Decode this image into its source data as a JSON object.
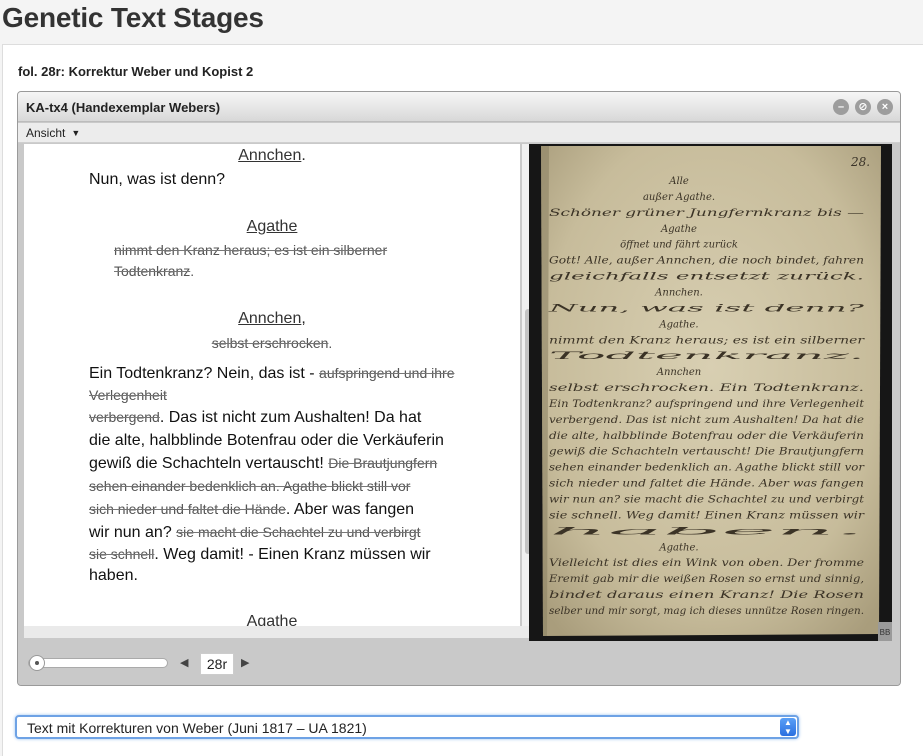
{
  "page": {
    "title": "Genetic Text Stages",
    "folio_title": "fol. 28r: Korrektur Weber und Kopist 2"
  },
  "viewer": {
    "title": "KA-tx4 (Handexemplar Webers)",
    "menu": {
      "view_label": "Ansicht"
    },
    "window_buttons": [
      "minimize",
      "restore",
      "close"
    ]
  },
  "edition": {
    "speaker_1": "Annchen",
    "speaker_1_punct": ".",
    "line_1": "Nun, was ist denn?",
    "speaker_2": "Agathe",
    "stage_2a": "nimmt den Kranz heraus; es ist ein silberner",
    "stage_2b": "Todtenkranz",
    "stage_2b_punct": ".",
    "speaker_3": "Annchen",
    "speaker_3_punct": ",",
    "stage_3": "selbst erschrocken",
    "stage_3_punct": ".",
    "l1_text": "Ein Todtenkranz? Nein, das ist - ",
    "l1_stage": "aufspringend und ihre",
    "l2_stage": "Verlegenheit",
    "l3_stage": "verbergend",
    "l3_text": ". Das ist nicht zum Aushalten! Da hat",
    "l4_text": "die alte, halbblinde Botenfrau oder die Verkäuferin",
    "l5_text": "gewiß die Schachteln vertauscht! ",
    "l5_stage": "Die Brautjungfern",
    "l6_stage": "sehen einander bedenklich an. Agathe blickt still vor",
    "l7_stage": "sich nieder und faltet die Hände",
    "l7_text": ". Aber was fangen",
    "l8_text": "wir nun an? ",
    "l8_stage": "sie macht die Schachtel zu und verbirgt",
    "l9_stage": "sie schnell",
    "l9_text": ". Weg damit! - Einen Kranz müssen wir",
    "l10_text": "haben.",
    "speaker_4": "Agathe"
  },
  "manuscript": {
    "folio_number": "28.",
    "corner_mark": "BB",
    "lines": [
      "Alle",
      "außer Agathe.",
      "Schöner grüner Jungfernkranz bis —",
      "Agathe",
      "öffnet und fährt zurück",
      "Gott! Alle, außer Annchen, die noch bindet, fahren",
      "gleichfalls entsetzt zurück.",
      "Annchen.",
      "Nun, was ist denn?",
      "Agathe.",
      "nimmt den Kranz heraus; es ist ein silberner",
      "Todtenkranz.",
      "Annchen",
      "selbst erschrocken. Ein Todtenkranz.",
      "Ein Todtenkranz? aufspringend und ihre Verlegenheit",
      "verbergend. Das ist nicht zum Aushalten! Da hat die",
      "die alte, halbblinde Botenfrau oder die Verkäuferin",
      "gewiß die Schachteln vertauscht! Die Brautjungfern",
      "sehen einander bedenklich an. Agathe blickt still vor",
      "sich nieder und faltet die Hände. Aber was fangen",
      "wir nun an? sie macht die Schachtel zu und verbirgt",
      "sie schnell. Weg damit! Einen Kranz müssen wir",
      "haben.",
      "Agathe.",
      "Vielleicht ist dies ein Wink von oben. Der fromme",
      "Eremit gab mir die weißen Rosen so ernst und sinnig,",
      "bindet daraus einen Kranz! Die Rosen",
      "selber und mir sorgt, mag ich dieses unnütze Rosen ringen."
    ]
  },
  "controls": {
    "page_value": "28r",
    "slider_value": 0.0
  },
  "select": {
    "selected": "Text mit Korrekturen von Weber (Juni 1817 – UA 1821)"
  }
}
